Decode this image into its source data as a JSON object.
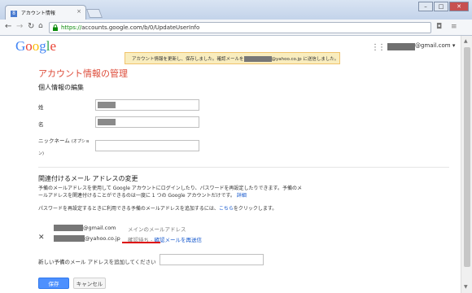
{
  "browser": {
    "tab_title": "アカウント情報",
    "tab_close": "×",
    "favicon": "8",
    "url_scheme": "https://",
    "url_rest": "accounts.google.com/b/0/UpdateUserInfo",
    "win_min": "–",
    "win_max": "□",
    "win_close": "✕"
  },
  "header": {
    "logo_letters": [
      {
        "ch": "G",
        "color": "#4285f4"
      },
      {
        "ch": "o",
        "color": "#ea4335"
      },
      {
        "ch": "o",
        "color": "#fbbc05"
      },
      {
        "ch": "g",
        "color": "#4285f4"
      },
      {
        "ch": "l",
        "color": "#34a853"
      },
      {
        "ch": "e",
        "color": "#ea4335"
      }
    ],
    "apps_icon": "⋮⋮⋮",
    "account_suffix": "@gmail.com ▾"
  },
  "notice": {
    "before": "アカウント情報を更新し、保存しました。確認メールを",
    "after": "@yahoo.co.jp に送信しました。"
  },
  "main": {
    "title": "アカウント情報の管理",
    "personal_heading": "個人情報の編集",
    "last_name_label": "姓",
    "first_name_label": "名",
    "nickname_label": "ニックネーム",
    "nickname_opt": "(オプショ",
    "nickname_opt2": "ン)",
    "email_heading": "関連付けるメール アドレスの変更",
    "desc1": "予備のメールアドレスを使用して Google アカウントにログインしたり、パスワードを再設定したりできます。予備のメ",
    "desc2": "ールアドレスを関連付けることができるのは一度に 1 つの Google アカウントだけです。",
    "desc2_link": "詳細",
    "recover_text": "パスワードを再設定するときに利用できる予備のメールアドレスを追加するには、",
    "recover_link": "こちら",
    "recover_after": "をクリックします。",
    "primary_suffix": "@gmail.com",
    "primary_label": "メインのメールアドレス",
    "remove_icon": "✕",
    "backup_suffix": "@yahoo.co.jp",
    "pending_label": "確認待ち",
    "pending_sep": " - ",
    "resend_link": "確認メールを再送信",
    "add_label": "新しい予備のメール アドレスを追加してください",
    "save": "保存",
    "cancel": "キャンセル"
  }
}
